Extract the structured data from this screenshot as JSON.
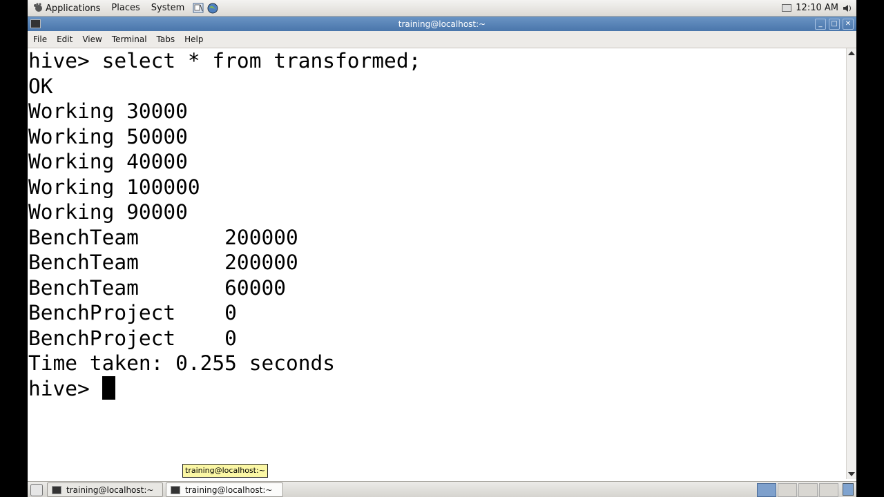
{
  "top_panel": {
    "menus": [
      "Applications",
      "Places",
      "System"
    ],
    "clock": "12:10 AM"
  },
  "window": {
    "title": "training@localhost:~",
    "menu": [
      "File",
      "Edit",
      "View",
      "Terminal",
      "Tabs",
      "Help"
    ]
  },
  "terminal": {
    "lines": [
      "hive> select * from transformed;",
      "OK",
      "Working 30000",
      "Working 50000",
      "Working 40000",
      "Working 100000",
      "Working 90000",
      "BenchTeam       200000",
      "BenchTeam       200000",
      "BenchTeam       60000",
      "BenchProject    0",
      "BenchProject    0",
      "Time taken: 0.255 seconds"
    ],
    "prompt": "hive> "
  },
  "tooltip": "training@localhost:~",
  "taskbar": {
    "tasks": [
      "training@localhost:~",
      "training@localhost:~"
    ]
  }
}
